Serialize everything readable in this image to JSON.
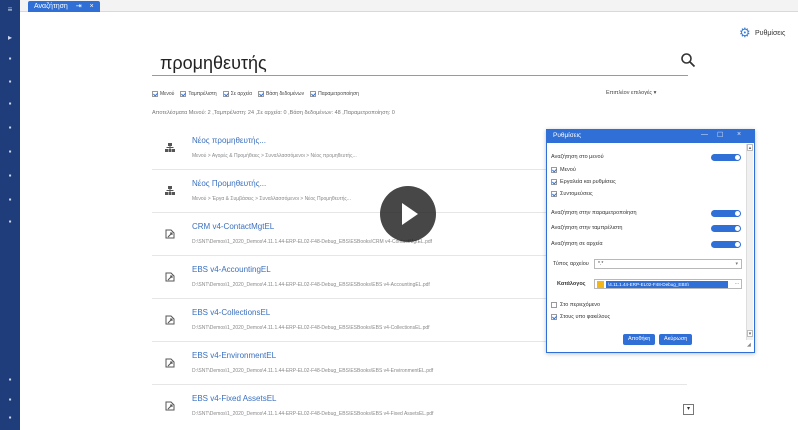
{
  "tab": {
    "label": "Αναζήτηση",
    "pin": "⇥",
    "close": "×"
  },
  "settings_link": {
    "label": "Ρυθμίσεις"
  },
  "search": {
    "value": "προμηθευτής"
  },
  "filters": [
    {
      "label": "Μενού",
      "checked": true
    },
    {
      "label": "Ταμπρέλιστη",
      "checked": true
    },
    {
      "label": "Σε αρχεία",
      "checked": true
    },
    {
      "label": "Βάση δεδομένων",
      "checked": true
    },
    {
      "label": "Παραμετροποίηση",
      "checked": true
    }
  ],
  "select_options": "Επιπλέον επιλογές ▾",
  "results_count": "Αποτελέσματα Μενού: 2 ,Ταμπρέλιστη: 24 ,Σε αρχεία: 0 ,Βάση δεδομένων: 48 ,Παραμετροποίηση: 0",
  "results": [
    {
      "title": "Νέος προμηθευτής...",
      "path": "Μενού > Αγορές & Προμήθειες > Συναλλασσόμενοι > Νέος προμηθευτής...",
      "icon": "org-chart-icon"
    },
    {
      "title": "Νέος Προμηθευτής...",
      "path": "Μενού > Έργα & Συμβάσεις > Συναλλασσόμενοι > Νέος Προμηθευτής...",
      "icon": "org-chart-icon"
    },
    {
      "title": "CRM v4-ContactMgtEL",
      "path": "D:\\SNT\\Demos\\1_2020_Demos\\4.11.1.44-ERP-EL02-F48-Debug_EBS\\ESBooks\\CRM v4-ContactMgtEL.pdf",
      "icon": "file-link-icon"
    },
    {
      "title": "EBS v4-AccountingEL",
      "path": "D:\\SNT\\Demos\\1_2020_Demos\\4.11.1.44-ERP-EL02-F48-Debug_EBS\\ESBooks\\EBS v4-AccountingEL.pdf",
      "icon": "file-link-icon"
    },
    {
      "title": "EBS v4-CollectionsEL",
      "path": "D:\\SNT\\Demos\\1_2020_Demos\\4.11.1.44-ERP-EL02-F48-Debug_EBS\\ESBooks\\EBS v4-CollectionsEL.pdf",
      "icon": "file-link-icon"
    },
    {
      "title": "EBS v4-EnvironmentEL",
      "path": "D:\\SNT\\Demos\\1_2020_Demos\\4.11.1.44-ERP-EL02-F48-Debug_EBS\\ESBooks\\EBS v4-EnvironmentEL.pdf",
      "icon": "file-link-icon"
    },
    {
      "title": "EBS v4-Fixed AssetsEL",
      "path": "D:\\SNT\\Demos\\1_2020_Demos\\4.11.1.44-ERP-EL02-F48-Debug_EBS\\ESBooks\\EBS v4-Fixed AssetsEL.pdf",
      "icon": "file-link-icon"
    }
  ],
  "popup": {
    "title": "Ρυθμίσεις",
    "controls": {
      "min": "—",
      "max": "☐",
      "close": "×"
    },
    "search_menu": "Αναζήτηση στο μενού",
    "menu_subitems": [
      "Μενού",
      "Εργαλεία και ρυθμίσεις",
      "Συντομεύσεις"
    ],
    "search_params": "Αναζήτηση στην παραμετροποίηση",
    "search_tabs": "Αναζήτηση στην ταμπρέλιστη",
    "search_files": "Αναζήτηση σε αρχεία",
    "file_type_label": "Τύπος αρχείου",
    "file_type_value": "*.*",
    "folder_label": "Κατάλογος",
    "folder_value": "\\4.11.1.44-ERP-EL02-F48-Debug_EBS\\",
    "folder_more": "...",
    "opt_content": "Στο περιεχόμενο",
    "opt_subfolders": "Στους υπο φακέλους",
    "save": "Αποθήκη",
    "cancel": "Ακύρωση"
  },
  "colors": {
    "accent": "#2f6fd6",
    "rail": "#1f3d7a"
  }
}
